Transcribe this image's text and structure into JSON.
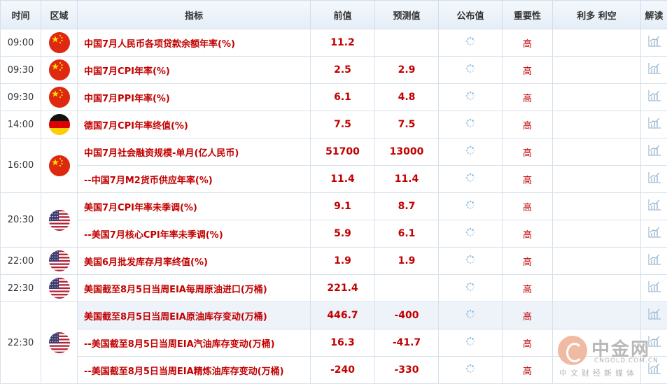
{
  "header": {
    "time": "时间",
    "region": "区域",
    "indicator": "指标",
    "prev": "前值",
    "forecast": "预测值",
    "actual": "公布值",
    "importance": "重要性",
    "effect": "利多 利空",
    "analysis": "解读"
  },
  "rows": [
    {
      "time": "09:00",
      "flag": "cn",
      "indicator": "中国7月人民币各项贷款余额年率(%)",
      "prev": "11.2",
      "forecast": "",
      "importance": "高"
    },
    {
      "time": "09:30",
      "flag": "cn",
      "indicator": "中国7月CPI年率(%)",
      "prev": "2.5",
      "forecast": "2.9",
      "importance": "高"
    },
    {
      "time": "09:30",
      "flag": "cn",
      "indicator": "中国7月PPI年率(%)",
      "prev": "6.1",
      "forecast": "4.8",
      "importance": "高"
    },
    {
      "time": "14:00",
      "flag": "de",
      "indicator": "德国7月CPI年率终值(%)",
      "prev": "7.5",
      "forecast": "7.5",
      "importance": "高"
    },
    {
      "time": "16:00",
      "flag": "cn",
      "indicator": "中国7月社会融资规模-单月(亿人民币)",
      "prev": "51700",
      "forecast": "13000",
      "importance": "高"
    },
    {
      "time": "",
      "flag": "",
      "indicator": "--中国7月M2货币供应年率(%)",
      "prev": "11.4",
      "forecast": "11.4",
      "importance": "高"
    },
    {
      "time": "20:30",
      "flag": "us",
      "indicator": "美国7月CPI年率未季调(%)",
      "prev": "9.1",
      "forecast": "8.7",
      "importance": "高"
    },
    {
      "time": "",
      "flag": "",
      "indicator": "--美国7月核心CPI年率未季调(%)",
      "prev": "5.9",
      "forecast": "6.1",
      "importance": "高"
    },
    {
      "time": "22:00",
      "flag": "us",
      "indicator": "美国6月批发库存月率终值(%)",
      "prev": "1.9",
      "forecast": "1.9",
      "importance": "高"
    },
    {
      "time": "22:30",
      "flag": "us",
      "indicator": "美国截至8月5日当周EIA每周原油进口(万桶)",
      "prev": "221.4",
      "forecast": "",
      "importance": "高"
    },
    {
      "time": "22:30",
      "flag": "us",
      "indicator": "美国截至8月5日当周EIA原油库存变动(万桶)",
      "prev": "446.7",
      "forecast": "-400",
      "importance": "高"
    },
    {
      "time": "",
      "flag": "",
      "indicator": "--美国截至8月5日当周EIA汽油库存变动(万桶)",
      "prev": "16.3",
      "forecast": "-41.7",
      "importance": "高"
    },
    {
      "time": "",
      "flag": "",
      "indicator": "--美国截至8月5日当周EIA精炼油库存变动(万桶)",
      "prev": "-240",
      "forecast": "-330",
      "importance": "高"
    }
  ],
  "watermark": {
    "title": "中金网",
    "domain": "CNGOLD.COM.CN",
    "sub": "中文财经新媒体"
  },
  "colors": {
    "indicator": "#c20000",
    "header_bg": "#e4edf7",
    "border": "#d7e1ec"
  },
  "icons": {
    "cn": "china-flag-icon",
    "de": "germany-flag-icon",
    "us": "usa-flag-icon",
    "actual": "loading-spinner-icon",
    "analysis": "chart-icon"
  }
}
